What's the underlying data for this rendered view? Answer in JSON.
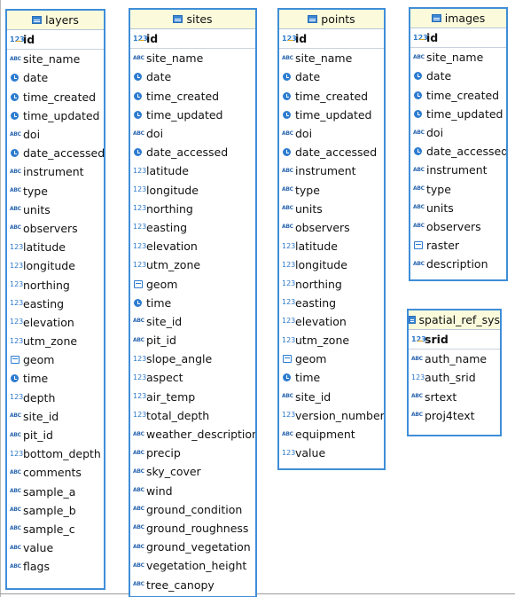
{
  "tables": [
    {
      "name": "layers",
      "pk": "id",
      "fields": [
        {
          "name": "site_name",
          "type": "abc"
        },
        {
          "name": "date",
          "type": "date"
        },
        {
          "name": "time_created",
          "type": "date"
        },
        {
          "name": "time_updated",
          "type": "date"
        },
        {
          "name": "doi",
          "type": "abc"
        },
        {
          "name": "date_accessed",
          "type": "date"
        },
        {
          "name": "instrument",
          "type": "abc"
        },
        {
          "name": "type",
          "type": "abc"
        },
        {
          "name": "units",
          "type": "abc"
        },
        {
          "name": "observers",
          "type": "abc"
        },
        {
          "name": "latitude",
          "type": "num"
        },
        {
          "name": "longitude",
          "type": "num"
        },
        {
          "name": "northing",
          "type": "num"
        },
        {
          "name": "easting",
          "type": "num"
        },
        {
          "name": "elevation",
          "type": "num"
        },
        {
          "name": "utm_zone",
          "type": "num"
        },
        {
          "name": "geom",
          "type": "geom"
        },
        {
          "name": "time",
          "type": "date"
        },
        {
          "name": "depth",
          "type": "num"
        },
        {
          "name": "site_id",
          "type": "abc"
        },
        {
          "name": "pit_id",
          "type": "abc"
        },
        {
          "name": "bottom_depth",
          "type": "num"
        },
        {
          "name": "comments",
          "type": "abc"
        },
        {
          "name": "sample_a",
          "type": "abc"
        },
        {
          "name": "sample_b",
          "type": "abc"
        },
        {
          "name": "sample_c",
          "type": "abc"
        },
        {
          "name": "value",
          "type": "abc"
        },
        {
          "name": "flags",
          "type": "abc"
        }
      ]
    },
    {
      "name": "sites",
      "pk": "id",
      "fields": [
        {
          "name": "site_name",
          "type": "abc"
        },
        {
          "name": "date",
          "type": "date"
        },
        {
          "name": "time_created",
          "type": "date"
        },
        {
          "name": "time_updated",
          "type": "date"
        },
        {
          "name": "doi",
          "type": "abc"
        },
        {
          "name": "date_accessed",
          "type": "date"
        },
        {
          "name": "latitude",
          "type": "num"
        },
        {
          "name": "longitude",
          "type": "num"
        },
        {
          "name": "northing",
          "type": "num"
        },
        {
          "name": "easting",
          "type": "num"
        },
        {
          "name": "elevation",
          "type": "num"
        },
        {
          "name": "utm_zone",
          "type": "num"
        },
        {
          "name": "geom",
          "type": "geom"
        },
        {
          "name": "time",
          "type": "date"
        },
        {
          "name": "site_id",
          "type": "abc"
        },
        {
          "name": "pit_id",
          "type": "abc"
        },
        {
          "name": "slope_angle",
          "type": "num"
        },
        {
          "name": "aspect",
          "type": "num"
        },
        {
          "name": "air_temp",
          "type": "num"
        },
        {
          "name": "total_depth",
          "type": "num"
        },
        {
          "name": "weather_description",
          "type": "abc"
        },
        {
          "name": "precip",
          "type": "abc"
        },
        {
          "name": "sky_cover",
          "type": "abc"
        },
        {
          "name": "wind",
          "type": "abc"
        },
        {
          "name": "ground_condition",
          "type": "abc"
        },
        {
          "name": "ground_roughness",
          "type": "abc"
        },
        {
          "name": "ground_vegetation",
          "type": "abc"
        },
        {
          "name": "vegetation_height",
          "type": "abc"
        },
        {
          "name": "tree_canopy",
          "type": "abc"
        }
      ]
    },
    {
      "name": "points",
      "pk": "id",
      "fields": [
        {
          "name": "site_name",
          "type": "abc"
        },
        {
          "name": "date",
          "type": "date"
        },
        {
          "name": "time_created",
          "type": "date"
        },
        {
          "name": "time_updated",
          "type": "date"
        },
        {
          "name": "doi",
          "type": "abc"
        },
        {
          "name": "date_accessed",
          "type": "date"
        },
        {
          "name": "instrument",
          "type": "abc"
        },
        {
          "name": "type",
          "type": "abc"
        },
        {
          "name": "units",
          "type": "abc"
        },
        {
          "name": "observers",
          "type": "abc"
        },
        {
          "name": "latitude",
          "type": "num"
        },
        {
          "name": "longitude",
          "type": "num"
        },
        {
          "name": "northing",
          "type": "num"
        },
        {
          "name": "easting",
          "type": "num"
        },
        {
          "name": "elevation",
          "type": "num"
        },
        {
          "name": "utm_zone",
          "type": "num"
        },
        {
          "name": "geom",
          "type": "geom"
        },
        {
          "name": "time",
          "type": "date"
        },
        {
          "name": "site_id",
          "type": "abc"
        },
        {
          "name": "version_number",
          "type": "num"
        },
        {
          "name": "equipment",
          "type": "abc"
        },
        {
          "name": "value",
          "type": "num"
        }
      ]
    },
    {
      "name": "images",
      "pk": "id",
      "fields": [
        {
          "name": "site_name",
          "type": "abc"
        },
        {
          "name": "date",
          "type": "date"
        },
        {
          "name": "time_created",
          "type": "date"
        },
        {
          "name": "time_updated",
          "type": "date"
        },
        {
          "name": "doi",
          "type": "abc"
        },
        {
          "name": "date_accessed",
          "type": "date"
        },
        {
          "name": "instrument",
          "type": "abc"
        },
        {
          "name": "type",
          "type": "abc"
        },
        {
          "name": "units",
          "type": "abc"
        },
        {
          "name": "observers",
          "type": "abc"
        },
        {
          "name": "raster",
          "type": "geom"
        },
        {
          "name": "description",
          "type": "abc"
        }
      ]
    },
    {
      "name": "spatial_ref_sys",
      "pk": "srid",
      "fields": [
        {
          "name": "auth_name",
          "type": "abc"
        },
        {
          "name": "auth_srid",
          "type": "num"
        },
        {
          "name": "srtext",
          "type": "abc"
        },
        {
          "name": "proj4text",
          "type": "abc"
        }
      ]
    }
  ],
  "type_icons": {
    "abc": "text-type-icon",
    "num": "numeric-type-icon",
    "date": "datetime-type-icon",
    "geom": "geometry-type-icon",
    "key": "primary-key-icon",
    "table": "table-icon"
  },
  "colors": {
    "border": "#3f8ed8",
    "header_bg": "#fbfbdc",
    "icon_blue": "#2d7cd0"
  }
}
